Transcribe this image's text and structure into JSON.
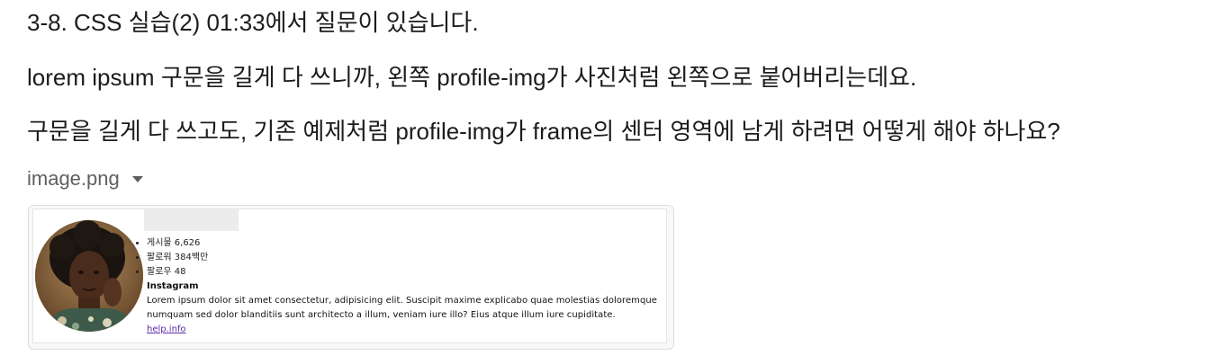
{
  "message": {
    "line1": "3-8. CSS 실습(2) 01:33에서 질문이 있습니다.",
    "line2": "lorem ipsum 구문을 길게 다 쓰니까, 왼쪽 profile-img가 사진처럼 왼쪽으로 붙어버리는데요.",
    "line3": "구문을 길게 다 쓰고도, 기존 예제처럼 profile-img가 frame의 센터 영역에 남게 하려면 어떻게 해야 하나요?"
  },
  "attachment": {
    "filename": "image.png",
    "preview": {
      "stats": [
        {
          "label": "게시물 6,626"
        },
        {
          "label": "팔로워 384백만"
        },
        {
          "label": "팔로우 48"
        }
      ],
      "name": "Instagram",
      "bio": "Lorem ipsum dolor sit amet consectetur, adipisicing elit. Suscipit maxime explicabo quae molestias doloremque numquam sed dolor blanditiis sunt architecto a illum, veniam iure illo? Eius atque illum iure cupiditate.",
      "link": "help.info"
    }
  },
  "colors": {
    "text": "#1d1c1d",
    "muted": "#616061",
    "link": "#5a2aa8"
  }
}
